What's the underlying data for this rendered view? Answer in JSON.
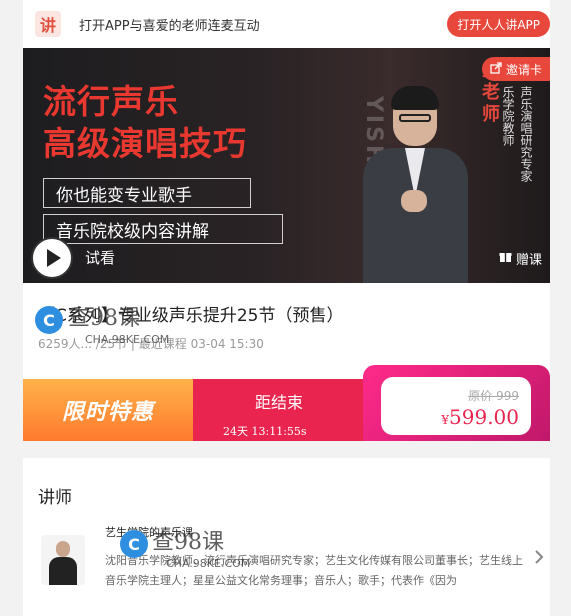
{
  "topbar": {
    "logo_char": "讲",
    "text": "打开APP与喜爱的老师连麦互动",
    "open_app": "打开人人讲APP"
  },
  "banner": {
    "title_line1": "流行声乐",
    "title_line2": "高级演唱技巧",
    "subtitle1": "你也能变专业歌手",
    "subtitle2": "音乐院校级内容讲解",
    "teacher_name_fragment": "生老师",
    "teacher_title_fragment_1": "乐学院教师",
    "teacher_title_fragment_2": "声乐演唱研究专家",
    "watermark": "YISHENG",
    "invite": "邀请卡",
    "preview": "试看",
    "gift": "赠课"
  },
  "course": {
    "title": "【C系列】专业级声乐提升25节（预售）",
    "meta": "6259人... /25节 | 最近课程 03-04 15:30"
  },
  "watermark": {
    "logo_char": "C",
    "text": "查98课",
    "sub": "CHA.98KE.COM"
  },
  "promo": {
    "label": "限时特惠",
    "countdown_label": "距结束",
    "countdown_time": "24天 13:11:55s",
    "original_price": "原价 999",
    "currency": "¥",
    "sale_price": "599.00"
  },
  "lecturer": {
    "heading": "讲师",
    "name": "艺生学院的声乐课",
    "description": "沈阳音乐学院教师、流行声乐演唱研究专家；艺生文化传媒有限公司董事长；艺生线上音乐学院主理人；星星公益文化常务理事；音乐人；歌手；代表作《因为"
  },
  "icons": {
    "arrow": "chevron-right-icon",
    "gift": "gift-icon",
    "invite": "share-icon",
    "play": "play-icon"
  }
}
